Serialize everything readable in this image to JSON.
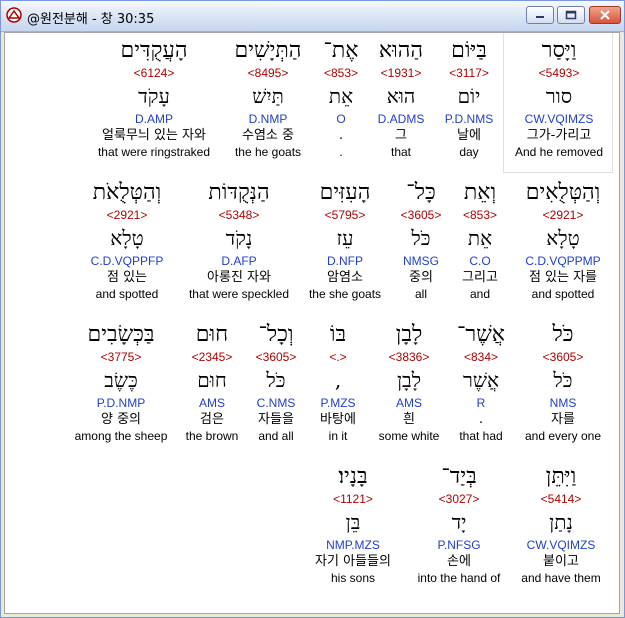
{
  "window": {
    "title": "@원전분해 - 창 30:35",
    "accent": "#B00000",
    "parse_color": "#1F3FD0"
  },
  "rows": [
    [
      {
        "heb": "וַיָּסַר",
        "strong": "<5493>",
        "lemma": "סור",
        "parse": "CW.VQIMZS",
        "kor": "그가-가리고",
        "eng": "And he removed"
      },
      {
        "heb": "בַּיּוֹם",
        "strong": "<3117>",
        "lemma": "יוֹם",
        "parse": "P.D.NMS",
        "kor": "날에",
        "eng": "day"
      },
      {
        "heb": "הַהוּא",
        "strong": "<1931>",
        "lemma": "הוּא",
        "parse": "D.ADMS",
        "kor": "그",
        "eng": "that"
      },
      {
        "heb": "אֶת־",
        "strong": "<853>",
        "lemma": "אֵת",
        "parse": "O",
        "kor": ".",
        "eng": "."
      },
      {
        "heb": "הַתְּיָשִׁים",
        "strong": "<8495>",
        "lemma": "תַּיִשׁ",
        "parse": "D.NMP",
        "kor": "수염소 중",
        "eng": "the he goats"
      },
      {
        "heb": "הָעֲקֻדִּים",
        "strong": "<6124>",
        "lemma": "עָקֹד",
        "parse": "D.AMP",
        "kor": "얼룩무늬 있는 자와",
        "eng": "that were ringstraked"
      }
    ],
    [
      {
        "heb": "וְהַטְּלֻאִים",
        "strong": "<2921>",
        "lemma": "טָלָא",
        "parse": "C.D.VQPPMP",
        "kor": "점 있는 자를",
        "eng": "and spotted"
      },
      {
        "heb": "וְאֵת",
        "strong": "<853>",
        "lemma": "אֵת",
        "parse": "C.O",
        "kor": "그리고",
        "eng": "and"
      },
      {
        "heb": "כָּל־",
        "strong": "<3605>",
        "lemma": "כֹּל",
        "parse": "NMSG",
        "kor": "중의",
        "eng": "all"
      },
      {
        "heb": "הָעִזִּים",
        "strong": "<5795>",
        "lemma": "עֵז",
        "parse": "D.NFP",
        "kor": "암염소",
        "eng": "the she goats"
      },
      {
        "heb": "הַנְּקֻדּוֹת",
        "strong": "<5348>",
        "lemma": "נָקֹד",
        "parse": "D.AFP",
        "kor": "아롱진 자와",
        "eng": "that were speckled"
      },
      {
        "heb": "וְהַטְּלֻאֹת",
        "strong": "<2921>",
        "lemma": "טָלָא",
        "parse": "C.D.VQPPFP",
        "kor": "점 있는",
        "eng": "and spotted"
      }
    ],
    [
      {
        "heb": "כֹּל",
        "strong": "<3605>",
        "lemma": "כֹּל",
        "parse": "NMS",
        "kor": "자를",
        "eng": "and every one"
      },
      {
        "heb": "אֲשֶׁר־",
        "strong": "<834>",
        "lemma": "אֲשֶׁר",
        "parse": "R",
        "kor": ".",
        "eng": "that had"
      },
      {
        "heb": "לָבָן",
        "strong": "<3836>",
        "lemma": "לָבָן",
        "parse": "AMS",
        "kor": "흰",
        "eng": "some white"
      },
      {
        "heb": "בּוֹ",
        "strong": "<.>",
        "lemma": ",",
        "parse": "P.MZS",
        "kor": "바탕에",
        "eng": "in it"
      },
      {
        "heb": "וְכָל־",
        "strong": "<3605>",
        "lemma": "כֹּל",
        "parse": "C.NMS",
        "kor": "자들을",
        "eng": "and all"
      },
      {
        "heb": "חוּם",
        "strong": "<2345>",
        "lemma": "חוּם",
        "parse": "AMS",
        "kor": "검은",
        "eng": "the brown"
      },
      {
        "heb": "בַּכְּשָׂבִים",
        "strong": "<3775>",
        "lemma": "כֶּשֶׂב",
        "parse": "P.D.NMP",
        "kor": "양 중의",
        "eng": "among the sheep"
      }
    ],
    [
      {
        "heb": "וַיִּתֵּן",
        "strong": "<5414>",
        "lemma": "נָתַן",
        "parse": "CW.VQIMZS",
        "kor": "붙이고",
        "eng": "and have them"
      },
      {
        "heb": "בְּיַד־",
        "strong": "<3027>",
        "lemma": "יָד",
        "parse": "P.NFSG",
        "kor": "손에",
        "eng": "into the hand of"
      },
      {
        "heb": "בָּנָיו׃",
        "strong": "<1121>",
        "lemma": "בֵּן",
        "parse": "NMP.MZS",
        "kor": "자기 아들들의",
        "eng": "his sons"
      }
    ]
  ]
}
